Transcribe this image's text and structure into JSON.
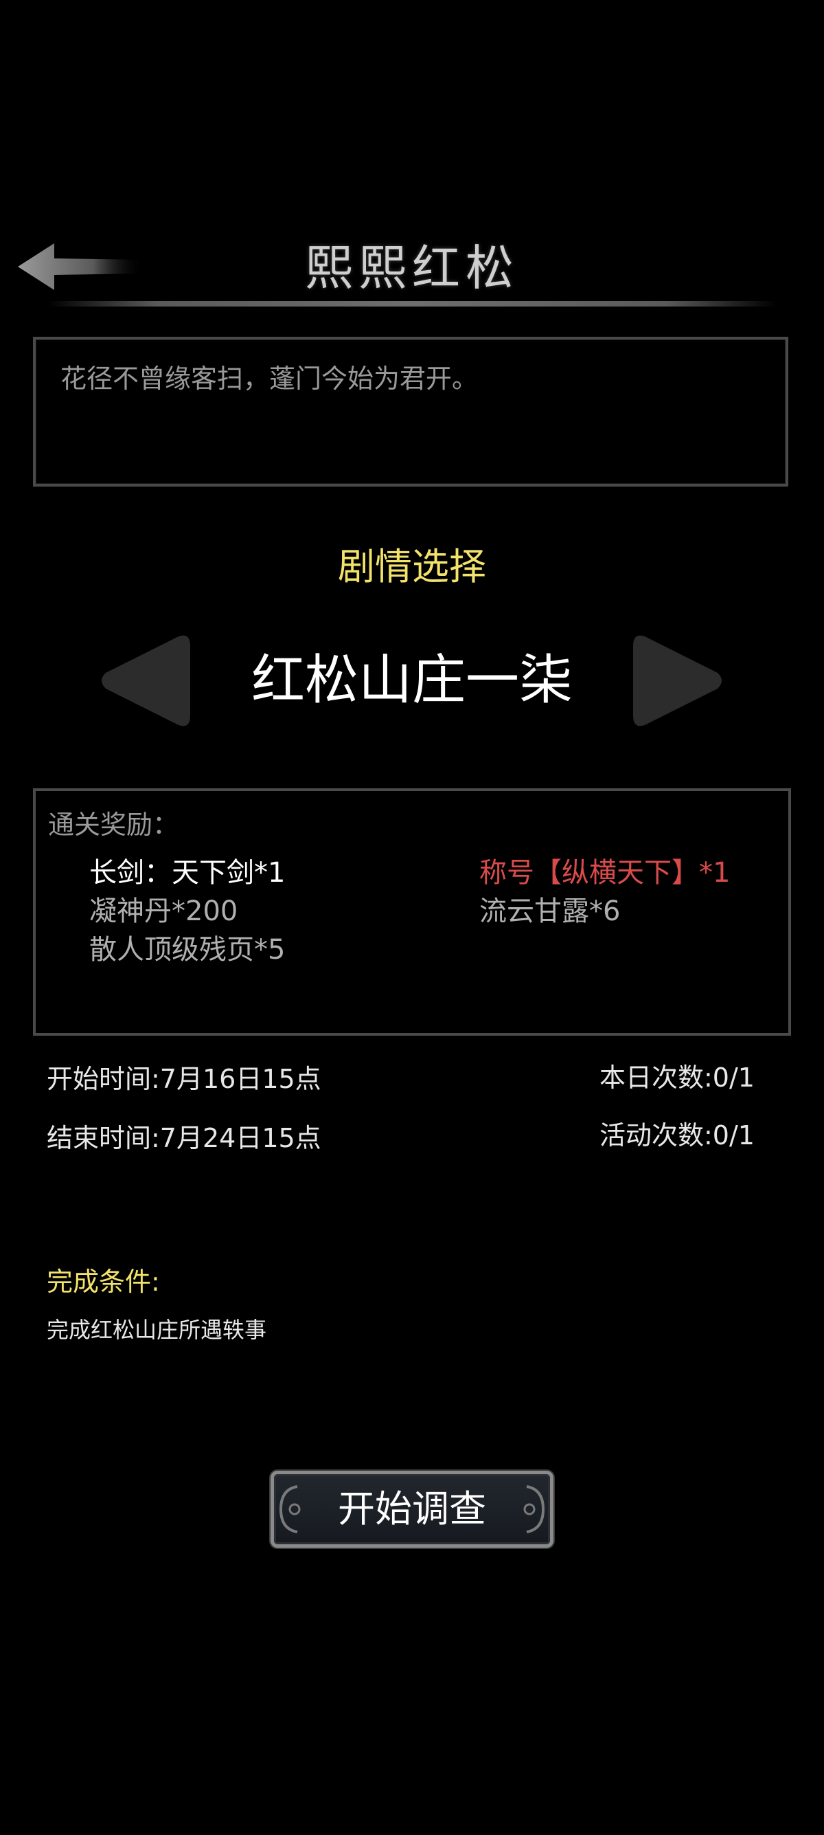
{
  "header": {
    "title": "熙熙红松"
  },
  "description": "花径不曾缘客扫，蓬门今始为君开。",
  "plot_select": {
    "label": "剧情选择",
    "chapter": "红松山庄一柒"
  },
  "rewards": {
    "label": "通关奖励：",
    "items": [
      {
        "text": "长剑：天下剑*1",
        "color": "#ffffff"
      },
      {
        "text": "称号【纵横天下】*1",
        "color": "#d94b4b"
      },
      {
        "text": "凝神丹*200",
        "color": "#b0b0b0"
      },
      {
        "text": "流云甘露*6",
        "color": "#b0b0b0"
      },
      {
        "text": "散人顶级残页*5",
        "color": "#b0b0b0"
      }
    ]
  },
  "times": {
    "start": "开始时间:7月16日15点",
    "end": "结束时间:7月24日15点",
    "daily_count": "本日次数:0/1",
    "event_count": "活动次数:0/1"
  },
  "condition": {
    "label": "完成条件:",
    "text": "完成红松山庄所遇轶事"
  },
  "start_button": {
    "label": "开始调查"
  },
  "colors": {
    "accent_yellow": "#f3e36a",
    "reward_red": "#d94b4b",
    "border_gray": "#4a4a4a"
  }
}
